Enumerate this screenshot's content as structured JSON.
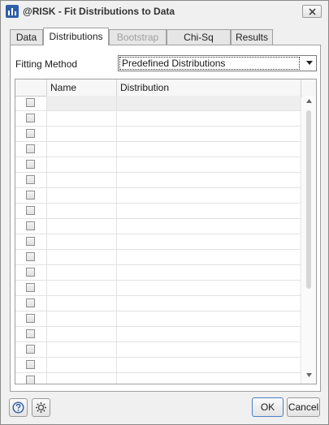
{
  "window": {
    "title": "@RISK - Fit Distributions to Data",
    "app_icon": "risk-chart-icon",
    "close_icon": "close-icon"
  },
  "tabs": [
    {
      "label": "Data",
      "state": "normal"
    },
    {
      "label": "Distributions",
      "state": "active"
    },
    {
      "label": "Bootstrap",
      "state": "disabled"
    },
    {
      "label": "Chi-Sq Binning",
      "state": "normal"
    },
    {
      "label": "Results",
      "state": "normal"
    }
  ],
  "fitting": {
    "label": "Fitting Method",
    "selected": "Predefined Distributions",
    "arrow_icon": "chevron-down-icon"
  },
  "grid": {
    "columns": [
      "",
      "Name",
      "Distribution"
    ],
    "row_count": 18,
    "rows": [
      {
        "checked": false,
        "name": "",
        "distribution": ""
      },
      {
        "checked": false,
        "name": "",
        "distribution": ""
      },
      {
        "checked": false,
        "name": "",
        "distribution": ""
      },
      {
        "checked": false,
        "name": "",
        "distribution": ""
      },
      {
        "checked": false,
        "name": "",
        "distribution": ""
      },
      {
        "checked": false,
        "name": "",
        "distribution": ""
      },
      {
        "checked": false,
        "name": "",
        "distribution": ""
      },
      {
        "checked": false,
        "name": "",
        "distribution": ""
      },
      {
        "checked": false,
        "name": "",
        "distribution": ""
      },
      {
        "checked": false,
        "name": "",
        "distribution": ""
      },
      {
        "checked": false,
        "name": "",
        "distribution": ""
      },
      {
        "checked": false,
        "name": "",
        "distribution": ""
      },
      {
        "checked": false,
        "name": "",
        "distribution": ""
      },
      {
        "checked": false,
        "name": "",
        "distribution": ""
      },
      {
        "checked": false,
        "name": "",
        "distribution": ""
      },
      {
        "checked": false,
        "name": "",
        "distribution": ""
      },
      {
        "checked": false,
        "name": "",
        "distribution": ""
      },
      {
        "checked": false,
        "name": "",
        "distribution": ""
      },
      {
        "checked": false,
        "name": "",
        "distribution": ""
      }
    ]
  },
  "footer": {
    "help_icon": "help-icon",
    "settings_icon": "gear-icon",
    "ok_label": "OK",
    "cancel_label": "Cancel"
  },
  "colors": {
    "accent": "#2f5ea8",
    "default_button_border": "#4a7fc4"
  }
}
